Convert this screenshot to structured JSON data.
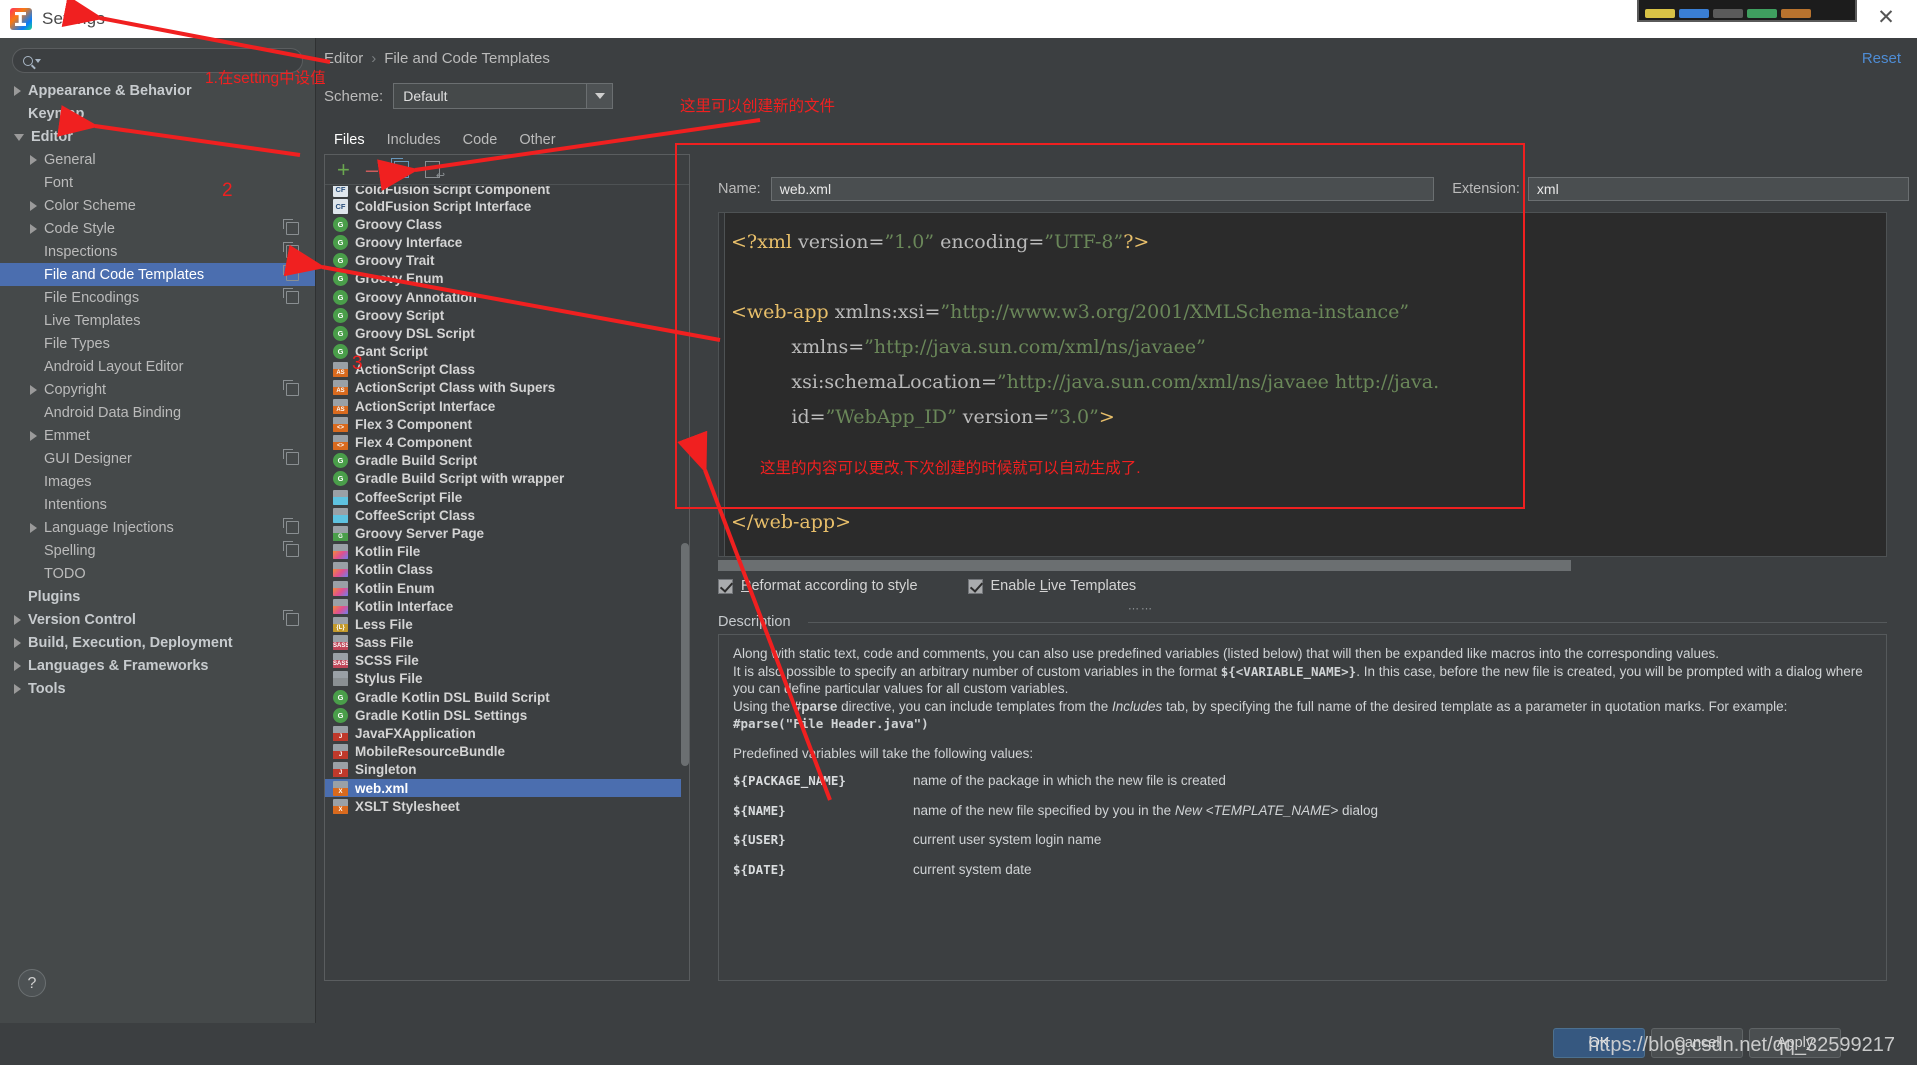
{
  "window": {
    "title": "Settings",
    "close_icon": "close-icon"
  },
  "sidebar": {
    "search_placeholder": "",
    "items": [
      {
        "label": "Appearance & Behavior",
        "indent": 0,
        "arrow": "right",
        "bold": true,
        "selected": false,
        "badge": false
      },
      {
        "label": "Keymap",
        "indent": 0,
        "arrow": "none",
        "bold": true,
        "selected": false,
        "badge": false
      },
      {
        "label": "Editor",
        "indent": 0,
        "arrow": "down",
        "bold": true,
        "selected": false,
        "badge": false
      },
      {
        "label": "General",
        "indent": 1,
        "arrow": "right",
        "bold": false,
        "selected": false,
        "badge": false
      },
      {
        "label": "Font",
        "indent": 1,
        "arrow": "none",
        "bold": false,
        "selected": false,
        "badge": false
      },
      {
        "label": "Color Scheme",
        "indent": 1,
        "arrow": "right",
        "bold": false,
        "selected": false,
        "badge": false
      },
      {
        "label": "Code Style",
        "indent": 1,
        "arrow": "right",
        "bold": false,
        "selected": false,
        "badge": true
      },
      {
        "label": "Inspections",
        "indent": 1,
        "arrow": "none",
        "bold": false,
        "selected": false,
        "badge": true
      },
      {
        "label": "File and Code Templates",
        "indent": 1,
        "arrow": "none",
        "bold": false,
        "selected": true,
        "badge": true
      },
      {
        "label": "File Encodings",
        "indent": 1,
        "arrow": "none",
        "bold": false,
        "selected": false,
        "badge": true
      },
      {
        "label": "Live Templates",
        "indent": 1,
        "arrow": "none",
        "bold": false,
        "selected": false,
        "badge": false
      },
      {
        "label": "File Types",
        "indent": 1,
        "arrow": "none",
        "bold": false,
        "selected": false,
        "badge": false
      },
      {
        "label": "Android Layout Editor",
        "indent": 1,
        "arrow": "none",
        "bold": false,
        "selected": false,
        "badge": false
      },
      {
        "label": "Copyright",
        "indent": 1,
        "arrow": "right",
        "bold": false,
        "selected": false,
        "badge": true
      },
      {
        "label": "Android Data Binding",
        "indent": 1,
        "arrow": "none",
        "bold": false,
        "selected": false,
        "badge": false
      },
      {
        "label": "Emmet",
        "indent": 1,
        "arrow": "right",
        "bold": false,
        "selected": false,
        "badge": false
      },
      {
        "label": "GUI Designer",
        "indent": 1,
        "arrow": "none",
        "bold": false,
        "selected": false,
        "badge": true
      },
      {
        "label": "Images",
        "indent": 1,
        "arrow": "none",
        "bold": false,
        "selected": false,
        "badge": false
      },
      {
        "label": "Intentions",
        "indent": 1,
        "arrow": "none",
        "bold": false,
        "selected": false,
        "badge": false
      },
      {
        "label": "Language Injections",
        "indent": 1,
        "arrow": "right",
        "bold": false,
        "selected": false,
        "badge": true
      },
      {
        "label": "Spelling",
        "indent": 1,
        "arrow": "none",
        "bold": false,
        "selected": false,
        "badge": true
      },
      {
        "label": "TODO",
        "indent": 1,
        "arrow": "none",
        "bold": false,
        "selected": false,
        "badge": false
      },
      {
        "label": "Plugins",
        "indent": 0,
        "arrow": "none",
        "bold": true,
        "selected": false,
        "badge": false
      },
      {
        "label": "Version Control",
        "indent": 0,
        "arrow": "right",
        "bold": true,
        "selected": false,
        "badge": true
      },
      {
        "label": "Build, Execution, Deployment",
        "indent": 0,
        "arrow": "right",
        "bold": true,
        "selected": false,
        "badge": false
      },
      {
        "label": "Languages & Frameworks",
        "indent": 0,
        "arrow": "right",
        "bold": true,
        "selected": false,
        "badge": false
      },
      {
        "label": "Tools",
        "indent": 0,
        "arrow": "right",
        "bold": true,
        "selected": false,
        "badge": false
      }
    ],
    "help_label": "?"
  },
  "header": {
    "breadcrumb_root": "Editor",
    "breadcrumb_sep": "›",
    "breadcrumb_leaf": "File and Code Templates",
    "reset_label": "Reset",
    "scheme_label": "Scheme:",
    "scheme_value": "Default"
  },
  "tabs": [
    {
      "label": "Files",
      "active": true
    },
    {
      "label": "Includes",
      "active": false
    },
    {
      "label": "Code",
      "active": false
    },
    {
      "label": "Other",
      "active": false
    }
  ],
  "list_toolbar": {
    "add_icon": "plus-icon",
    "remove_icon": "minus-icon",
    "copy_icon": "copy-icon",
    "reset_icon": "reset-template-icon",
    "add_label": "+",
    "remove_label": "–"
  },
  "templates": [
    {
      "label": "ColdFusion Script Component",
      "icon": "cf",
      "selected": false,
      "clipped": true
    },
    {
      "label": "ColdFusion Script Interface",
      "icon": "cf",
      "selected": false
    },
    {
      "label": "Groovy Class",
      "icon": "groovy",
      "selected": false
    },
    {
      "label": "Groovy Interface",
      "icon": "groovy",
      "selected": false
    },
    {
      "label": "Groovy Trait",
      "icon": "groovy",
      "selected": false
    },
    {
      "label": "Groovy Enum",
      "icon": "groovy",
      "selected": false
    },
    {
      "label": "Groovy Annotation",
      "icon": "groovy",
      "selected": false
    },
    {
      "label": "Groovy Script",
      "icon": "groovy",
      "selected": false
    },
    {
      "label": "Groovy DSL Script",
      "icon": "groovy",
      "selected": false
    },
    {
      "label": "Gant Script",
      "icon": "groovy",
      "selected": false
    },
    {
      "label": "ActionScript Class",
      "icon": "as",
      "selected": false
    },
    {
      "label": "ActionScript Class with Supers",
      "icon": "as",
      "selected": false
    },
    {
      "label": "ActionScript Interface",
      "icon": "as",
      "selected": false
    },
    {
      "label": "Flex 3 Component",
      "icon": "flex",
      "selected": false
    },
    {
      "label": "Flex 4 Component",
      "icon": "flex",
      "selected": false
    },
    {
      "label": "Gradle Build Script",
      "icon": "groovy",
      "selected": false
    },
    {
      "label": "Gradle Build Script with wrapper",
      "icon": "groovy",
      "selected": false
    },
    {
      "label": "CoffeeScript File",
      "icon": "coffee",
      "selected": false
    },
    {
      "label": "CoffeeScript Class",
      "icon": "coffee",
      "selected": false
    },
    {
      "label": "Groovy Server Page",
      "icon": "gsp",
      "selected": false
    },
    {
      "label": "Kotlin File",
      "icon": "kotlin",
      "selected": false
    },
    {
      "label": "Kotlin Class",
      "icon": "kotlin",
      "selected": false
    },
    {
      "label": "Kotlin Enum",
      "icon": "kotlin",
      "selected": false
    },
    {
      "label": "Kotlin Interface",
      "icon": "kotlin",
      "selected": false
    },
    {
      "label": "Less File",
      "icon": "less",
      "selected": false
    },
    {
      "label": "Sass File",
      "icon": "sass",
      "selected": false
    },
    {
      "label": "SCSS File",
      "icon": "sass",
      "selected": false
    },
    {
      "label": "Stylus File",
      "icon": "stylus",
      "selected": false
    },
    {
      "label": "Gradle Kotlin DSL Build Script",
      "icon": "groovy",
      "selected": false
    },
    {
      "label": "Gradle Kotlin DSL Settings",
      "icon": "groovy",
      "selected": false
    },
    {
      "label": "JavaFXApplication",
      "icon": "java",
      "selected": false
    },
    {
      "label": "MobileResourceBundle",
      "icon": "java",
      "selected": false
    },
    {
      "label": "Singleton",
      "icon": "java",
      "selected": false
    },
    {
      "label": "web.xml",
      "icon": "xml",
      "selected": true
    },
    {
      "label": "XSLT Stylesheet",
      "icon": "xml",
      "selected": false
    }
  ],
  "editor": {
    "name_label": "Name:",
    "name_value": "web.xml",
    "extension_label": "Extension:",
    "extension_value": "xml",
    "code_lines": [
      {
        "segments": [
          {
            "t": "<?xml ",
            "c": "tag"
          },
          {
            "t": "version=",
            "c": "attr"
          },
          {
            "t": "”1.0”",
            "c": "str"
          },
          {
            "t": " encoding=",
            "c": "attr"
          },
          {
            "t": "”UTF-8”",
            "c": "str"
          },
          {
            "t": "?>",
            "c": "tag"
          }
        ]
      },
      {
        "segments": []
      },
      {
        "segments": [
          {
            "t": "<web-app ",
            "c": "tag"
          },
          {
            "t": "xmlns:xsi=",
            "c": "attr"
          },
          {
            "t": "”http://www.w3.org/2001/XMLSchema-instance”",
            "c": "str"
          }
        ]
      },
      {
        "segments": [
          {
            "t": "          xmlns=",
            "c": "attr"
          },
          {
            "t": "”http://java.sun.com/xml/ns/javaee”",
            "c": "str"
          }
        ]
      },
      {
        "segments": [
          {
            "t": "          xsi:schemaLocation=",
            "c": "attr"
          },
          {
            "t": "”http://java.sun.com/xml/ns/javaee http://java.",
            "c": "str"
          }
        ]
      },
      {
        "segments": [
          {
            "t": "          id=",
            "c": "attr"
          },
          {
            "t": "”WebApp_ID”",
            "c": "str"
          },
          {
            "t": " version=",
            "c": "attr"
          },
          {
            "t": "”3.0”",
            "c": "str"
          },
          {
            "t": ">",
            "c": "tag"
          }
        ]
      },
      {
        "segments": []
      },
      {
        "segments": []
      },
      {
        "segments": [
          {
            "t": "</web-app>",
            "c": "tag"
          }
        ]
      }
    ],
    "reformat_label_pre": "R",
    "reformat_label_post": "eformat according to style",
    "livetpl_label_pre": "Enable ",
    "livetpl_label_mid": "L",
    "livetpl_label_post": "ive Templates",
    "reformat_checked": true,
    "livetpl_checked": true,
    "resize_dots": "⋯⋯"
  },
  "description": {
    "title": "Description",
    "paragraphs": [
      "Along with static text, code and comments, you can also use predefined variables (listed below) that will then be expanded like macros into the corresponding values.",
      "It is also possible to specify an arbitrary number of custom variables in the format ${<VARIABLE_NAME>}. In this case, before the new file is created, you will be prompted with a dialog where you can define particular values for all custom variables.",
      "Using the #parse directive, you can include templates from the Includes tab, by specifying the full name of the desired template as a parameter in quotation marks. For example:",
      "#parse(\"File Header.java\")"
    ],
    "variables_intro": "Predefined variables will take the following values:",
    "variables": [
      {
        "name": "${PACKAGE_NAME}",
        "desc": "name of the package in which the new file is created"
      },
      {
        "name": "${NAME}",
        "desc": "name of the new file specified by you in the New <TEMPLATE_NAME> dialog"
      },
      {
        "name": "${USER}",
        "desc": "current user system login name"
      },
      {
        "name": "${DATE}",
        "desc": "current system date"
      }
    ]
  },
  "footer": {
    "ok_label": "OK",
    "cancel_label": "Cancel",
    "apply_label": "Apply",
    "watermark": "https://blog.csdn.net/qq_32599217"
  },
  "annotations": {
    "note1": "1.在setting中设值",
    "note2": "2",
    "note3": "3",
    "note4": "这里可以创建新的文件",
    "note5": "这里的内容可以更改,下次创建的时候就可以自动生成了.",
    "accent_color": "#f02020"
  }
}
